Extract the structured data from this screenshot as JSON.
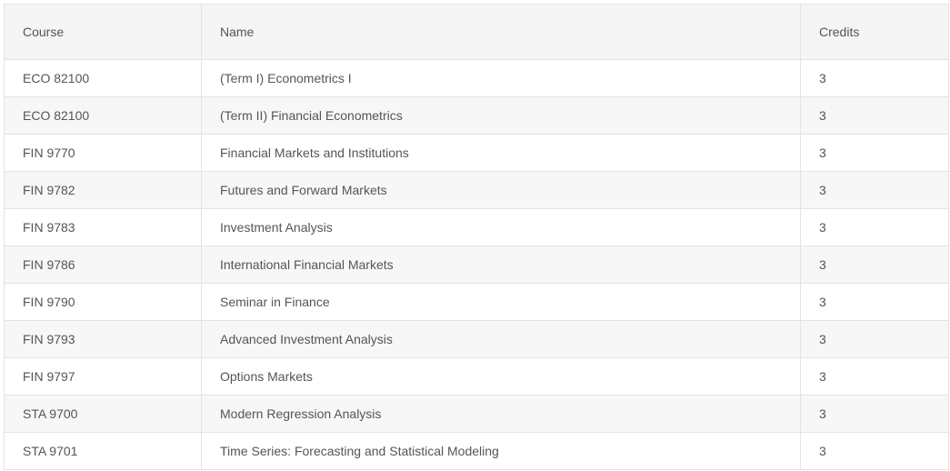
{
  "table": {
    "headers": {
      "course": "Course",
      "name": "Name",
      "credits": "Credits"
    },
    "rows": [
      {
        "course": "ECO 82100",
        "name": "(Term I) Econometrics I",
        "credits": "3"
      },
      {
        "course": "ECO 82100",
        "name": "(Term II) Financial Econometrics",
        "credits": "3"
      },
      {
        "course": "FIN 9770",
        "name": "Financial Markets and Institutions",
        "credits": "3"
      },
      {
        "course": "FIN 9782",
        "name": "Futures and Forward Markets",
        "credits": "3"
      },
      {
        "course": "FIN 9783",
        "name": "Investment Analysis",
        "credits": "3"
      },
      {
        "course": "FIN 9786",
        "name": "International Financial Markets",
        "credits": "3"
      },
      {
        "course": "FIN 9790",
        "name": "Seminar in Finance",
        "credits": "3"
      },
      {
        "course": "FIN 9793",
        "name": "Advanced Investment Analysis",
        "credits": "3"
      },
      {
        "course": "FIN 9797",
        "name": "Options Markets",
        "credits": "3"
      },
      {
        "course": "STA 9700",
        "name": "Modern Regression Analysis",
        "credits": "3"
      },
      {
        "course": "STA 9701",
        "name": "Time Series: Forecasting and Statistical Modeling",
        "credits": "3"
      }
    ]
  }
}
